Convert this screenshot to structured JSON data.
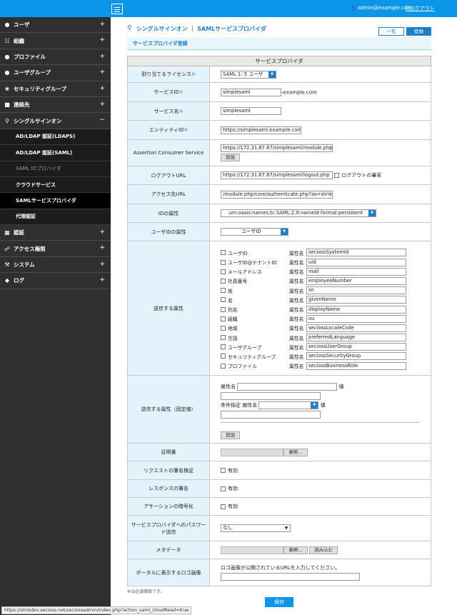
{
  "header": {
    "user": "admin@example.com",
    "logout": "ログアウト"
  },
  "sidebar": {
    "items": [
      {
        "label": "ユーザ",
        "icon": "user-icon",
        "toggle": "+"
      },
      {
        "label": "組織",
        "icon": "org-icon",
        "toggle": "+"
      },
      {
        "label": "プロファイル",
        "icon": "profile-icon",
        "toggle": "+"
      },
      {
        "label": "ユーザグループ",
        "icon": "group-icon",
        "toggle": "+"
      },
      {
        "label": "セキュリティグループ",
        "icon": "security-group-icon",
        "toggle": "+"
      },
      {
        "label": "連絡先",
        "icon": "contact-icon",
        "toggle": "+"
      },
      {
        "label": "シングルサインオン",
        "icon": "sso-icon",
        "toggle": "−"
      }
    ],
    "sso_sub": [
      {
        "label": "AD/LDAP 認証(LDAPS)"
      },
      {
        "label": "AD/LDAP 認証(SAML)"
      },
      {
        "label": "SAML IDプロバイダ"
      },
      {
        "label": "クラウドサービス"
      },
      {
        "label": "SAMLサービスプロバイダ"
      },
      {
        "label": "代理認証"
      }
    ],
    "items_after": [
      {
        "label": "認証",
        "icon": "auth-icon",
        "toggle": "+"
      },
      {
        "label": "アクセス権限",
        "icon": "access-icon",
        "toggle": "+"
      },
      {
        "label": "システム",
        "icon": "wrench-icon",
        "toggle": "+"
      },
      {
        "label": "ログ",
        "icon": "tag-icon",
        "toggle": "+"
      }
    ]
  },
  "page": {
    "title": "シングルサインオン ｜ SAMLサービスプロバイダ",
    "btn_list": "一覧",
    "btn_register": "登録",
    "subtitle": "サービスプロバイダ登録",
    "table_head": "サービスプロバイダ"
  },
  "form": {
    "license_label": "割り当てるライセンス",
    "license_value": "SAML 1: 5 ユーザ",
    "service_id_label": "サービスID",
    "service_id_value": "simplesaml",
    "service_id_suffix": "-example.com",
    "service_name_label": "サービス名",
    "service_name_value": "simplesaml",
    "entity_id_label": "エンティティID",
    "entity_id_value": "https://simplesaml.example.com",
    "acs_label": "Assertion Consumer Service",
    "acs_value": "https://172.31.67.67/simplesaml/module.php/sa",
    "add_label": "追加",
    "logout_label": "ログアウトURL",
    "logout_value": "https://172.31.67.67/simplesaml/logout.php",
    "logout_sign_label": "ログアウトの署名",
    "access_label": "アクセス先URL",
    "access_value": "/module.php/core/authenticate.php?as=slink-sp",
    "idattr_label": "IDの属性",
    "idattr_value": "urn:oasis:names:tc:SAML:2.0:nameid-format:persistent",
    "uidattr_label": "ユーザIDの属性",
    "uidattr_value": "ユーザID",
    "sendattr_label": "送信する属性",
    "attr_name_label": "属性名",
    "attrs": [
      {
        "name": "ユーザID",
        "value": "seciossSystemId"
      },
      {
        "name": "ユーザID@テナントID",
        "value": "uid"
      },
      {
        "name": "メールアドレス",
        "value": "mail"
      },
      {
        "name": "社員番号",
        "value": "employeeNumber"
      },
      {
        "name": "姓",
        "value": "sn"
      },
      {
        "name": "名",
        "value": "givenName"
      },
      {
        "name": "別名",
        "value": "displayName"
      },
      {
        "name": "組織",
        "value": "ou"
      },
      {
        "name": "地域",
        "value": "seciossLocaleCode"
      },
      {
        "name": "言語",
        "value": "preferredLanguage"
      },
      {
        "name": "ユーザグループ",
        "value": "seciossUserGroup"
      },
      {
        "name": "セキュリティグループ",
        "value": "seciossSecurityGroup"
      },
      {
        "name": "プロファイル",
        "value": "seciossBusinessRole"
      }
    ],
    "fixed_label": "送信する属性（固定値）",
    "fixed_attr_name": "属性名",
    "fixed_value_label": "値",
    "cond_label": "条件指定",
    "cert_label": "証明書",
    "browse_label": "参照...",
    "req_sign_label": "リクエストの署名検証",
    "enabled_label": "有効",
    "resp_sign_label": "レスポンスの署名",
    "assert_enc_label": "アサーションの暗号化",
    "pw_send_label": "サービスプロバイダへのパスワード送信",
    "pw_send_value": "なし",
    "metadata_label": "メタデータ",
    "load_label": "読み込む",
    "logo_label": "ポータルに表示するロゴ画像",
    "logo_hint": "ロゴ画像が公開されているURLを入力してください。"
  },
  "footer": {
    "note": "※は必須項目です。",
    "save": "保存",
    "status_url": "https://slinkdev.secioss.net/seciossadmin/index.php?action_saml_cloudRead=true"
  }
}
